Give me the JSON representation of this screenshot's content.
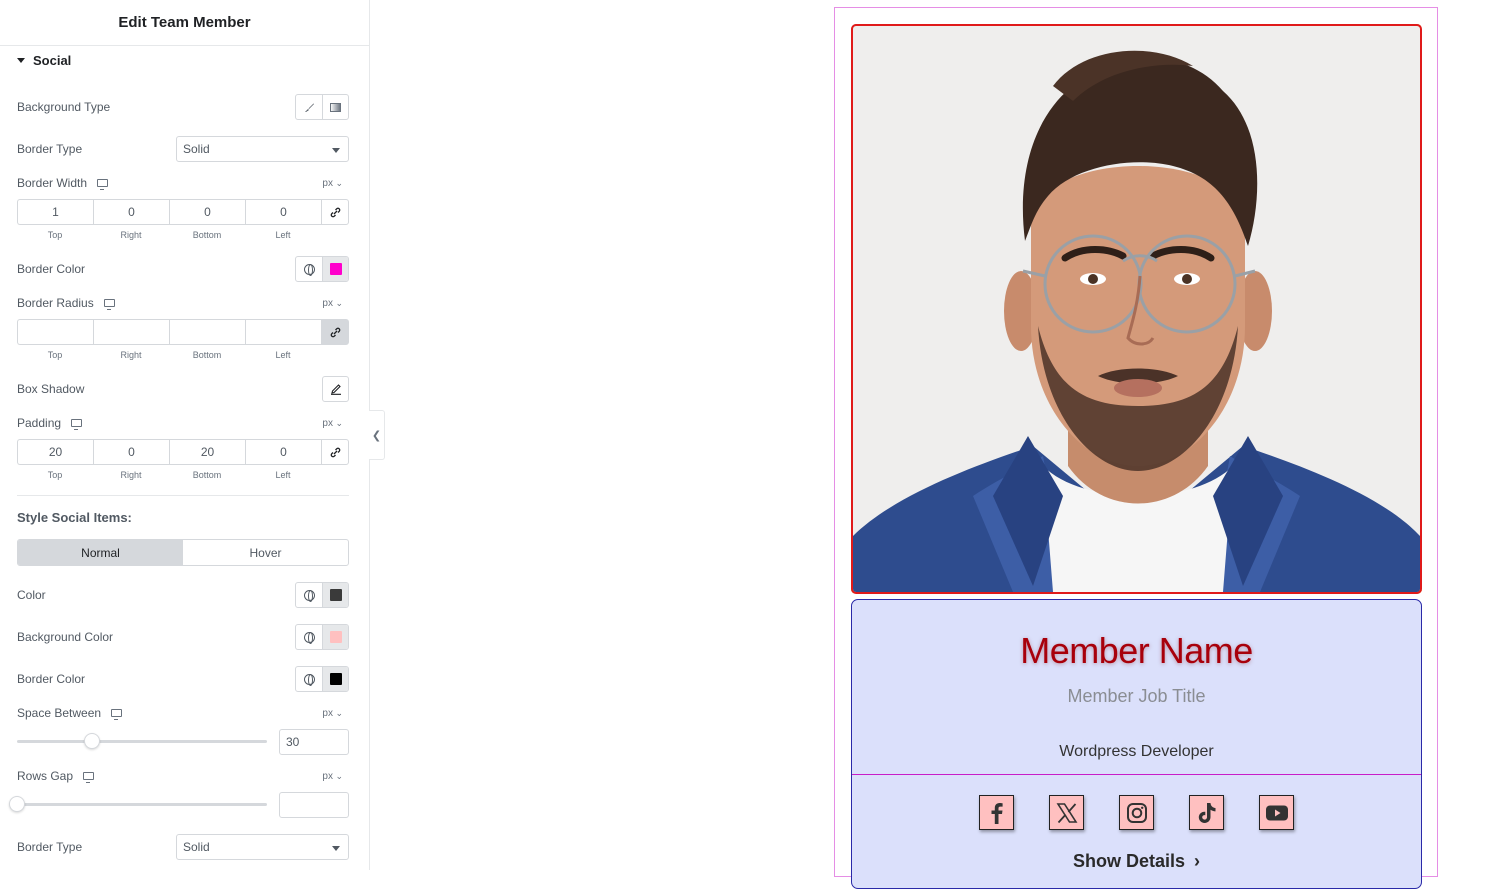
{
  "panel": {
    "title": "Edit Team Member",
    "section": "Social",
    "background_type_label": "Background Type",
    "border_type_label": "Border Type",
    "border_type_value": "Solid",
    "border_width_label": "Border Width",
    "unit": "px",
    "border_width": {
      "top": "1",
      "right": "0",
      "bottom": "0",
      "left": "0"
    },
    "dim_labels": {
      "top": "Top",
      "right": "Right",
      "bottom": "Bottom",
      "left": "Left"
    },
    "border_color_label": "Border Color",
    "border_color": "#ff00cc",
    "border_radius_label": "Border Radius",
    "border_radius": {
      "top": "",
      "right": "",
      "bottom": "",
      "left": ""
    },
    "box_shadow_label": "Box Shadow",
    "padding_label": "Padding",
    "padding": {
      "top": "20",
      "right": "0",
      "bottom": "20",
      "left": "0"
    },
    "style_items_heading": "Style Social Items:",
    "tab_normal": "Normal",
    "tab_hover": "Hover",
    "color_label": "Color",
    "color_value": "#3a3a3a",
    "bg_color_label": "Background Color",
    "bg_color_value": "#ffc0c0",
    "item_border_color_label": "Border Color",
    "item_border_color_value": "#000000",
    "space_between_label": "Space Between",
    "space_between_value": "30",
    "space_between_fraction": 0.3,
    "rows_gap_label": "Rows Gap",
    "rows_gap_value": "",
    "rows_gap_fraction": 0.0,
    "item_border_type_label": "Border Type",
    "item_border_type_value": "Solid"
  },
  "card": {
    "name": "Member Name",
    "job_title": "Member Job Title",
    "description": "Wordpress Developer",
    "socials": [
      "facebook-icon",
      "x-icon",
      "instagram-icon",
      "tiktok-icon",
      "youtube-icon"
    ],
    "show_details": "Show Details"
  }
}
